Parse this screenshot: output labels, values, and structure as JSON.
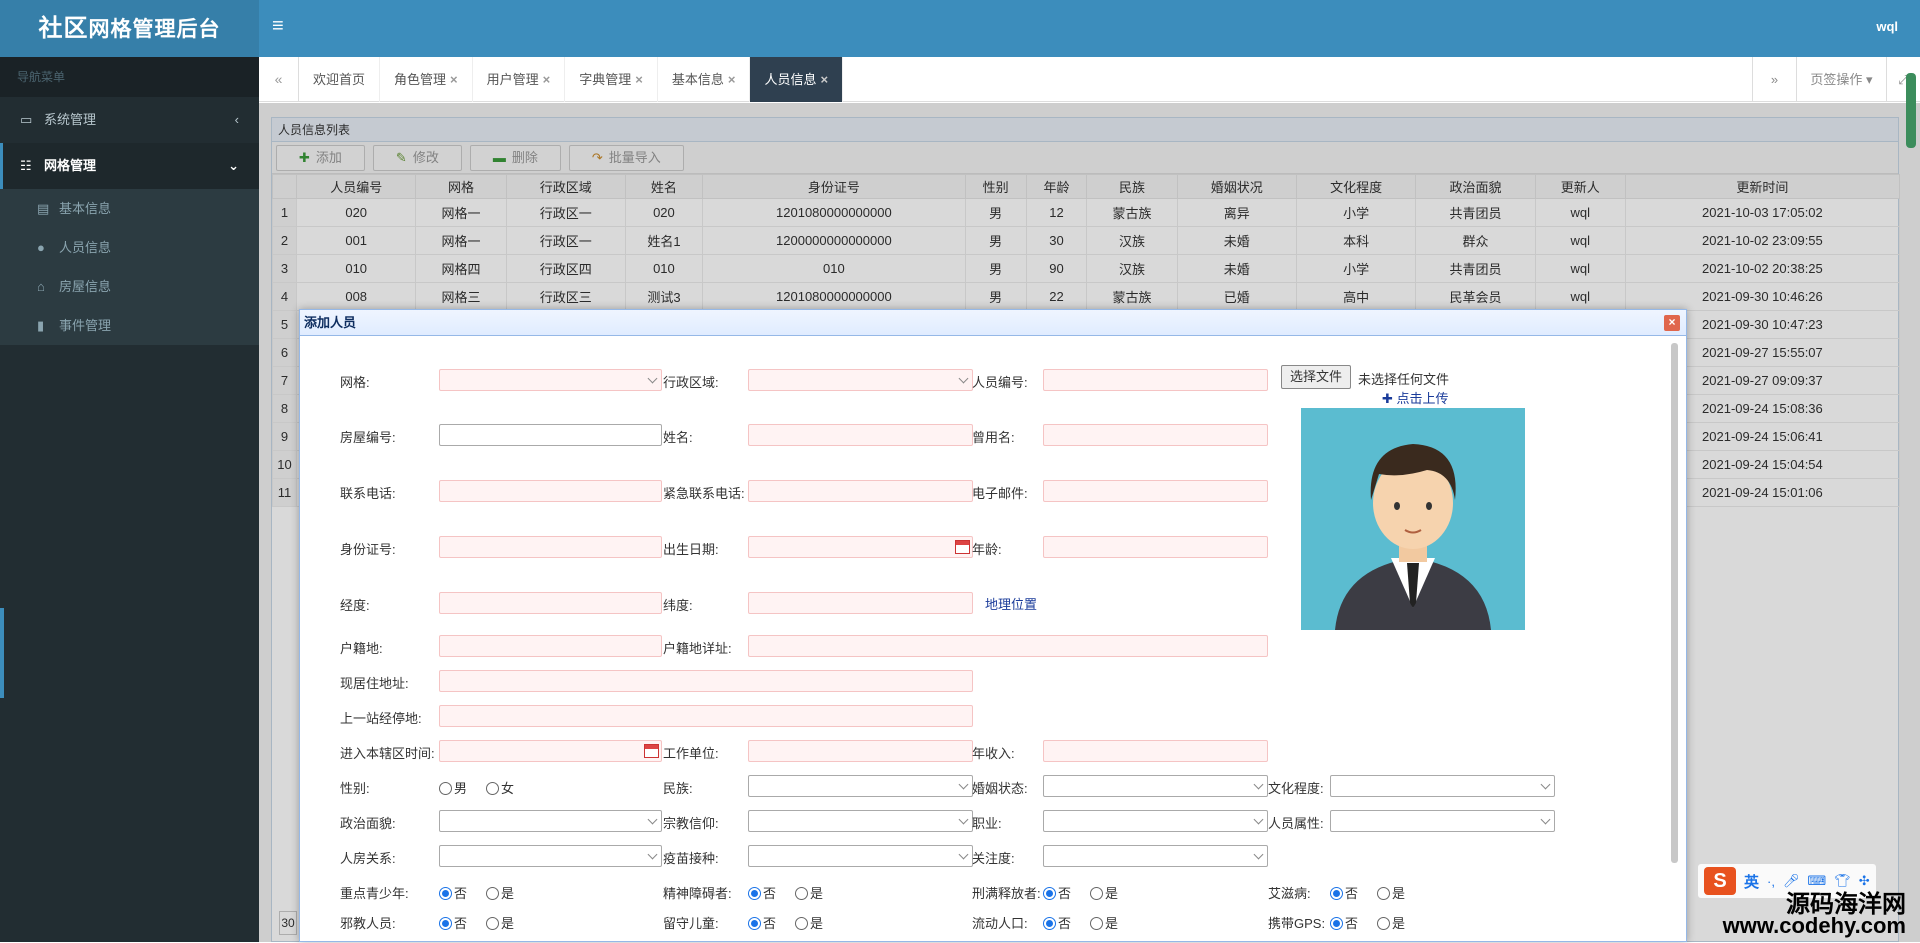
{
  "app": {
    "logo_main": "社区",
    "logo_sub": "网格管理后台",
    "user": "wql"
  },
  "sidebar": {
    "header": "导航菜单",
    "items": [
      {
        "label": "系统管理",
        "icon": "monitor-icon"
      },
      {
        "label": "网格管理",
        "icon": "grid-icon"
      }
    ],
    "subitems": [
      {
        "label": "基本信息",
        "icon": "book-icon"
      },
      {
        "label": "人员信息",
        "icon": "user-icon"
      },
      {
        "label": "房屋信息",
        "icon": "home-icon"
      },
      {
        "label": "事件管理",
        "icon": "file-icon"
      }
    ]
  },
  "tabs": [
    {
      "label": "欢迎首页",
      "closable": false
    },
    {
      "label": "角色管理",
      "closable": true
    },
    {
      "label": "用户管理",
      "closable": true
    },
    {
      "label": "字典管理",
      "closable": true
    },
    {
      "label": "基本信息",
      "closable": true
    },
    {
      "label": "人员信息",
      "closable": true,
      "active": true
    }
  ],
  "tab_actions": {
    "label": "页签操作"
  },
  "panel": {
    "title": "人员信息列表",
    "toolbar": {
      "add": "添加",
      "edit": "修改",
      "delete": "删除",
      "import": "批量导入"
    },
    "columns": [
      "人员编号",
      "网格",
      "行政区域",
      "姓名",
      "身份证号",
      "性别",
      "年龄",
      "民族",
      "婚姻状况",
      "文化程度",
      "政治面貌",
      "更新人",
      "更新时间"
    ],
    "rows": [
      {
        "n": "1",
        "cells": [
          "020",
          "网格一",
          "行政区一",
          "020",
          "1201080000000000",
          "男",
          "12",
          "蒙古族",
          "离异",
          "小学",
          "共青团员",
          "wql",
          "2021-10-03 17:05:02"
        ]
      },
      {
        "n": "2",
        "cells": [
          "001",
          "网格一",
          "行政区一",
          "姓名1",
          "1200000000000000",
          "男",
          "30",
          "汉族",
          "未婚",
          "本科",
          "群众",
          "wql",
          "2021-10-02 23:09:55"
        ]
      },
      {
        "n": "3",
        "cells": [
          "010",
          "网格四",
          "行政区四",
          "010",
          "010",
          "男",
          "90",
          "汉族",
          "未婚",
          "小学",
          "共青团员",
          "wql",
          "2021-10-02 20:38:25"
        ]
      },
      {
        "n": "4",
        "cells": [
          "008",
          "网格三",
          "行政区三",
          "测试3",
          "1201080000000000",
          "男",
          "22",
          "蒙古族",
          "已婚",
          "高中",
          "民革会员",
          "wql",
          "2021-09-30 10:46:26"
        ]
      },
      {
        "n": "5",
        "cells": [
          "",
          "",
          "",
          "",
          "",
          "",
          "",
          "",
          "",
          "",
          "",
          "",
          "2021-09-30 10:47:23"
        ]
      },
      {
        "n": "6",
        "cells": [
          "",
          "",
          "",
          "",
          "",
          "",
          "",
          "",
          "",
          "",
          "",
          "",
          "2021-09-27 15:55:07"
        ]
      },
      {
        "n": "7",
        "cells": [
          "",
          "",
          "",
          "",
          "",
          "",
          "",
          "",
          "",
          "",
          "",
          "",
          "2021-09-27 09:09:37"
        ]
      },
      {
        "n": "8",
        "cells": [
          "",
          "",
          "",
          "",
          "",
          "",
          "",
          "",
          "",
          "",
          "",
          "",
          "2021-09-24 15:08:36"
        ]
      },
      {
        "n": "9",
        "cells": [
          "",
          "",
          "",
          "",
          "",
          "",
          "",
          "",
          "",
          "",
          "",
          "",
          "2021-09-24 15:06:41"
        ]
      },
      {
        "n": "10",
        "cells": [
          "",
          "",
          "",
          "",
          "",
          "",
          "",
          "",
          "",
          "",
          "",
          "",
          "2021-09-24 15:04:54"
        ]
      },
      {
        "n": "11",
        "cells": [
          "",
          "",
          "",
          "",
          "",
          "",
          "",
          "",
          "",
          "",
          "",
          "",
          "2021-09-24 15:01:06"
        ]
      }
    ],
    "pager_value": "30"
  },
  "dialog": {
    "title": "添加人员",
    "labels": {
      "grid": "网格:",
      "region": "行政区域:",
      "person_no": "人员编号:",
      "house_no": "房屋编号:",
      "name": "姓名:",
      "alias": "曾用名:",
      "phone": "联系电话:",
      "emergency_phone": "紧急联系电话:",
      "email": "电子邮件:",
      "id_no": "身份证号:",
      "birth": "出生日期:",
      "age": "年龄:",
      "lng": "经度:",
      "lat": "纬度:",
      "geo_link": "地理位置",
      "huji": "户籍地:",
      "huji_detail": "户籍地详址:",
      "current_addr": "现居住地址:",
      "last_stop": "上一站经停地:",
      "enter_time": "进入本辖区时间:",
      "work": "工作单位:",
      "income": "年收入:",
      "gender": "性别:",
      "gender_male": "男",
      "gender_female": "女",
      "nation": "民族:",
      "marital": "婚姻状态:",
      "education": "文化程度:",
      "political": "政治面貌:",
      "religion": "宗教信仰:",
      "job": "职业:",
      "attr": "人员属性:",
      "relation": "人房关系:",
      "vaccine": "疫苗接种:",
      "attention": "关注度:",
      "youth": "重点青少年:",
      "mental": "精神障碍者:",
      "released": "刑满释放者:",
      "aids": "艾滋病:",
      "cult": "邪教人员:",
      "left_child": "留守儿童:",
      "floating": "流动人口:",
      "gps": "携带GPS:",
      "no": "否",
      "yes": "是"
    },
    "upload": {
      "button": "选择文件",
      "status": "未选择任何文件",
      "link": "点击上传"
    }
  },
  "watermark": {
    "line1": "源码海洋网",
    "line2": "www.codehy.com"
  },
  "ime": {
    "logo": "S",
    "lang": "英"
  }
}
